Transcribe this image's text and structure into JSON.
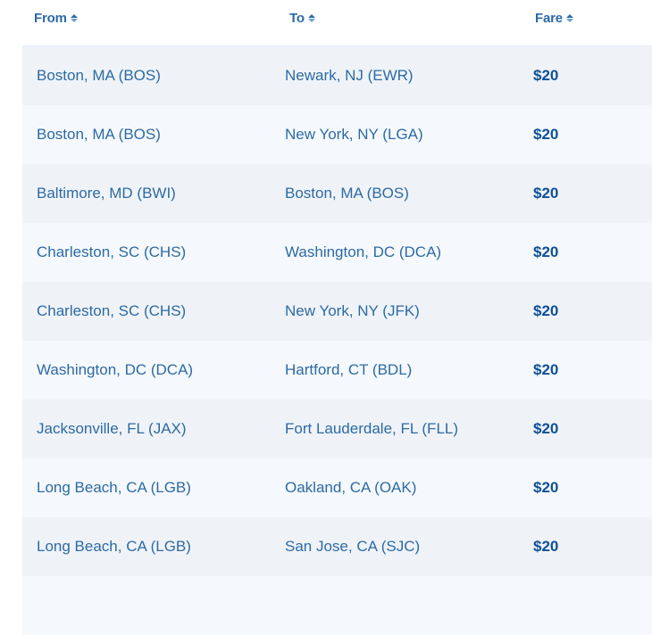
{
  "table": {
    "headers": {
      "from": "From",
      "to": "To",
      "fare": "Fare"
    },
    "sort_icon": "sort-up-down-icon",
    "rows": [
      {
        "from": "Boston, MA (BOS)",
        "to": "Newark, NJ (EWR)",
        "fare": "$20"
      },
      {
        "from": "Boston, MA (BOS)",
        "to": "New York, NY (LGA)",
        "fare": "$20"
      },
      {
        "from": "Baltimore, MD (BWI)",
        "to": "Boston, MA (BOS)",
        "fare": "$20"
      },
      {
        "from": "Charleston, SC (CHS)",
        "to": "Washington, DC (DCA)",
        "fare": "$20"
      },
      {
        "from": "Charleston, SC (CHS)",
        "to": "New York, NY (JFK)",
        "fare": "$20"
      },
      {
        "from": "Washington, DC (DCA)",
        "to": "Hartford, CT (BDL)",
        "fare": "$20"
      },
      {
        "from": "Jacksonville, FL (JAX)",
        "to": "Fort Lauderdale, FL (FLL)",
        "fare": "$20"
      },
      {
        "from": "Long Beach, CA (LGB)",
        "to": "Oakland, CA (OAK)",
        "fare": "$20"
      },
      {
        "from": "Long Beach, CA (LGB)",
        "to": "San Jose, CA (SJC)",
        "fare": "$20"
      }
    ]
  },
  "colors": {
    "header_text": "#2b6aa8",
    "cell_text": "#2d6aa3",
    "fare_text": "#0f4f96",
    "row_odd": "#eff3f8",
    "row_even": "#f5f9fd"
  }
}
